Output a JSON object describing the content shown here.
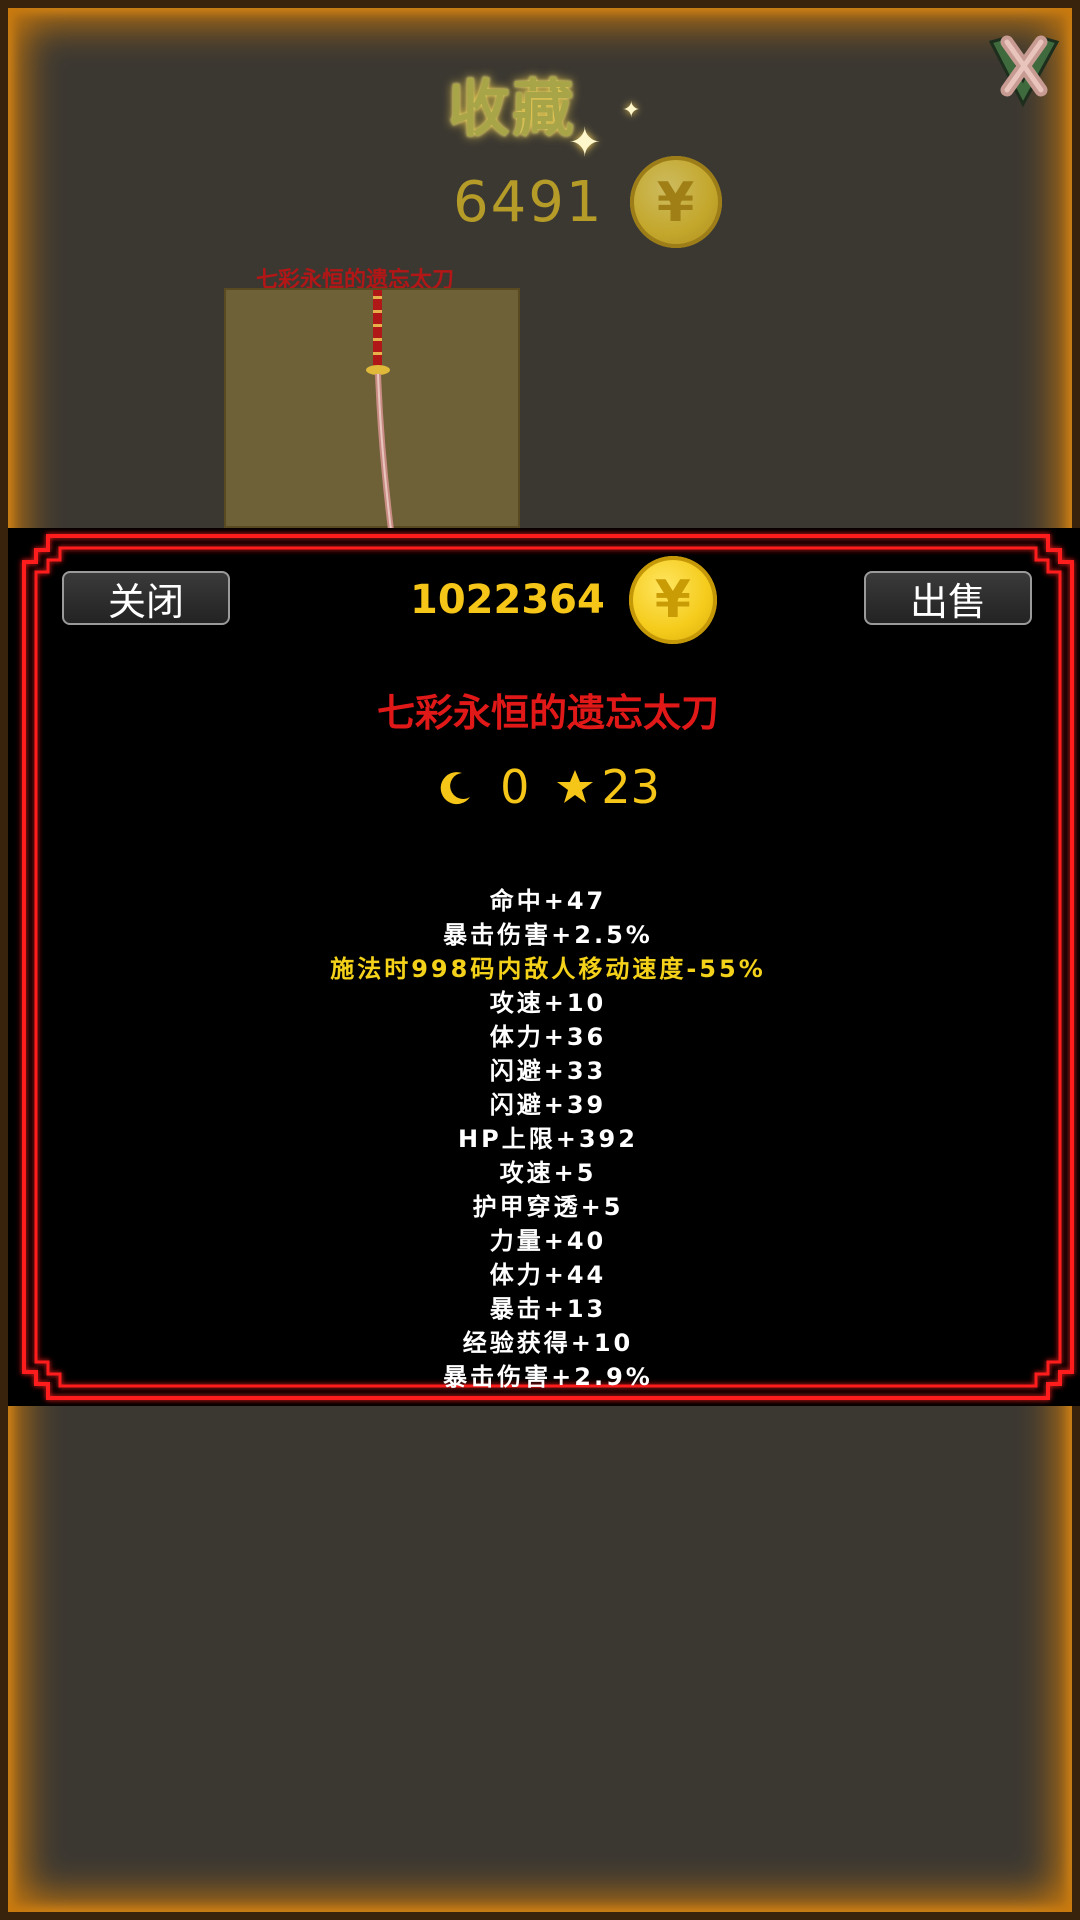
{
  "header": {
    "title": "收藏",
    "coins": "6491",
    "coin_symbol": "¥"
  },
  "collection": {
    "item_label": "七彩永恒的遗忘太刀"
  },
  "detail": {
    "close_label": "关闭",
    "sell_label": "出售",
    "money": "1022364",
    "coin_symbol": "¥",
    "item_name": "七彩永恒的遗忘太刀",
    "moon_level": "0",
    "star_level": "23",
    "stats": [
      {
        "text": "命中+47",
        "special": false
      },
      {
        "text": "暴击伤害+2.5%",
        "special": false
      },
      {
        "text": "施法时998码内敌人移动速度-55%",
        "special": true
      },
      {
        "text": "攻速+10",
        "special": false
      },
      {
        "text": "体力+36",
        "special": false
      },
      {
        "text": "闪避+33",
        "special": false
      },
      {
        "text": "闪避+39",
        "special": false
      },
      {
        "text": "HP上限+392",
        "special": false
      },
      {
        "text": "攻速+5",
        "special": false
      },
      {
        "text": "护甲穿透+5",
        "special": false
      },
      {
        "text": "力量+40",
        "special": false
      },
      {
        "text": "体力+44",
        "special": false
      },
      {
        "text": "暴击+13",
        "special": false
      },
      {
        "text": "经验获得+10",
        "special": false
      },
      {
        "text": "暴击伤害+2.9%",
        "special": false
      }
    ]
  },
  "colors": {
    "gold": "#f5c518",
    "item_red": "#e01818",
    "special_stat": "#f5d21a",
    "frame_red": "#ff1a1a",
    "glow_orange": "#c7780d"
  }
}
